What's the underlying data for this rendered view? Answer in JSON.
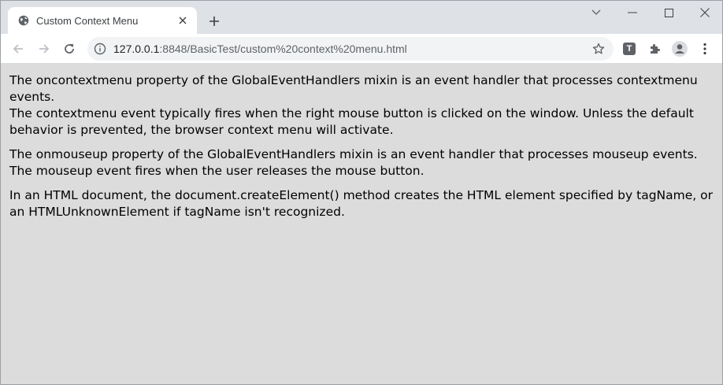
{
  "browser": {
    "tab": {
      "title": "Custom Context Menu",
      "favicon": "globe-icon"
    },
    "address": {
      "host": "127.0.0.1",
      "rest": ":8848/BasicTest/custom%20context%20menu.html"
    },
    "extension_label": "T"
  },
  "page": {
    "paragraphs": [
      {
        "line1": "The oncontextmenu property of the GlobalEventHandlers mixin is an event handler that processes contextmenu events.",
        "line2": "The contextmenu event typically fires when the right mouse button is clicked on the window. Unless the default behavior is prevented, the browser context menu will activate."
      },
      {
        "line1": "The onmouseup property of the GlobalEventHandlers mixin is an event handler that processes mouseup events.",
        "line2": "The mouseup event fires when the user releases the mouse button."
      },
      {
        "line1": "In an HTML document, the document.createElement() method creates the HTML element specified by tagName, or an HTMLUnknownElement if tagName isn't recognized."
      }
    ]
  },
  "colors": {
    "page_background": "#dcdcdc",
    "tabstrip": "#dee1e6",
    "omnibox": "#f1f3f4"
  }
}
